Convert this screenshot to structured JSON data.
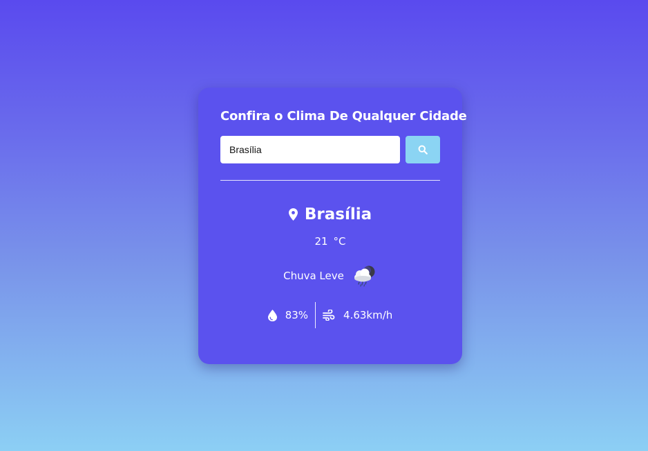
{
  "card": {
    "title": "Confira o Clima De Qualquer Cidade"
  },
  "search": {
    "value": "Brasília",
    "placeholder": "",
    "button_icon": "search-icon"
  },
  "weather": {
    "location_icon": "map-pin-icon",
    "city": "Brasília",
    "temperature": "21",
    "unit": "°C",
    "description": "Chuva Leve",
    "condition_icon": "rain-cloud-icon",
    "humidity_icon": "water-drop-icon",
    "humidity": "83%",
    "wind_icon": "wind-icon",
    "wind": "4.63km/h"
  },
  "colors": {
    "card_background": "#5b52ee",
    "search_button": "#8bd4f3",
    "text": "#ffffff"
  }
}
